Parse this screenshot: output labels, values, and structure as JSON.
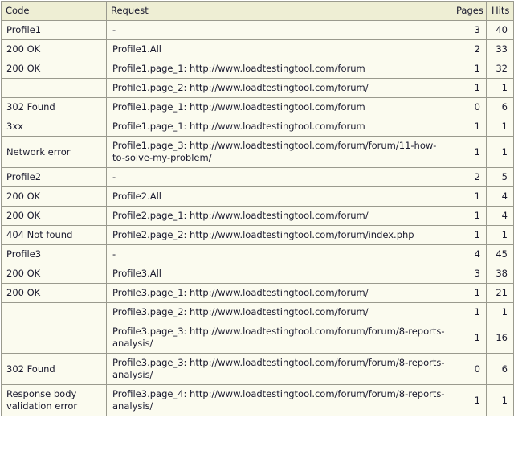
{
  "table": {
    "name": "load-test-request-report",
    "columns": [
      {
        "key": "code",
        "label": "Code"
      },
      {
        "key": "request",
        "label": "Request"
      },
      {
        "key": "pages",
        "label": "Pages"
      },
      {
        "key": "hits",
        "label": "Hits"
      }
    ],
    "colors": {
      "header_background": "#eeeed4",
      "cell_background": "#fbfbef",
      "border": "#9a9a8e",
      "text": "#1a1a2e",
      "page_background": "#ffffff"
    },
    "rows": [
      {
        "code": "Profile1",
        "request": "-",
        "pages": "3",
        "hits": "40",
        "lines": 1
      },
      {
        "code": "200 OK",
        "request": "Profile1.All",
        "pages": "2",
        "hits": "33",
        "lines": 1
      },
      {
        "code": "200 OK",
        "request": "Profile1.page_1: http://www.loadtestingtool.com/forum",
        "pages": "1",
        "hits": "32",
        "lines": 1
      },
      {
        "code": "",
        "request": "Profile1.page_2: http://www.loadtestingtool.com/forum/",
        "pages": "1",
        "hits": "1",
        "lines": 1
      },
      {
        "code": "302 Found",
        "request": "Profile1.page_1: http://www.loadtestingtool.com/forum",
        "pages": "0",
        "hits": "6",
        "lines": 1
      },
      {
        "code": "3xx",
        "request": "Profile1.page_1: http://www.loadtestingtool.com/forum",
        "pages": "1",
        "hits": "1",
        "lines": 1
      },
      {
        "code": "Network error",
        "request": "Profile1.page_3: http://www.loadtestingtool.com/forum/forum/11-how-to-solve-my-problem/",
        "pages": "1",
        "hits": "1",
        "lines": 2
      },
      {
        "code": "Profile2",
        "request": "-",
        "pages": "2",
        "hits": "5",
        "lines": 1
      },
      {
        "code": "200 OK",
        "request": "Profile2.All",
        "pages": "1",
        "hits": "4",
        "lines": 1
      },
      {
        "code": "200 OK",
        "request": "Profile2.page_1: http://www.loadtestingtool.com/forum/",
        "pages": "1",
        "hits": "4",
        "lines": 1
      },
      {
        "code": "404 Not found",
        "request": "Profile2.page_2: http://www.loadtestingtool.com/forum/index.php",
        "pages": "1",
        "hits": "1",
        "lines": 1
      },
      {
        "code": "Profile3",
        "request": "-",
        "pages": "4",
        "hits": "45",
        "lines": 1
      },
      {
        "code": "200 OK",
        "request": "Profile3.All",
        "pages": "3",
        "hits": "38",
        "lines": 1
      },
      {
        "code": "200 OK",
        "request": "Profile3.page_1: http://www.loadtestingtool.com/forum/",
        "pages": "1",
        "hits": "21",
        "lines": 1
      },
      {
        "code": "",
        "request": "Profile3.page_2: http://www.loadtestingtool.com/forum/",
        "pages": "1",
        "hits": "1",
        "lines": 1
      },
      {
        "code": "",
        "request": "Profile3.page_3: http://www.loadtestingtool.com/forum/forum/8-reports-analysis/",
        "pages": "1",
        "hits": "16",
        "lines": 2
      },
      {
        "code": "302 Found",
        "request": "Profile3.page_3: http://www.loadtestingtool.com/forum/forum/8-reports-analysis/",
        "pages": "0",
        "hits": "6",
        "lines": 2
      },
      {
        "code": "Response body validation error",
        "request": "Profile3.page_4: http://www.loadtestingtool.com/forum/forum/8-reports-analysis/",
        "pages": "1",
        "hits": "1",
        "lines": 2
      }
    ]
  }
}
